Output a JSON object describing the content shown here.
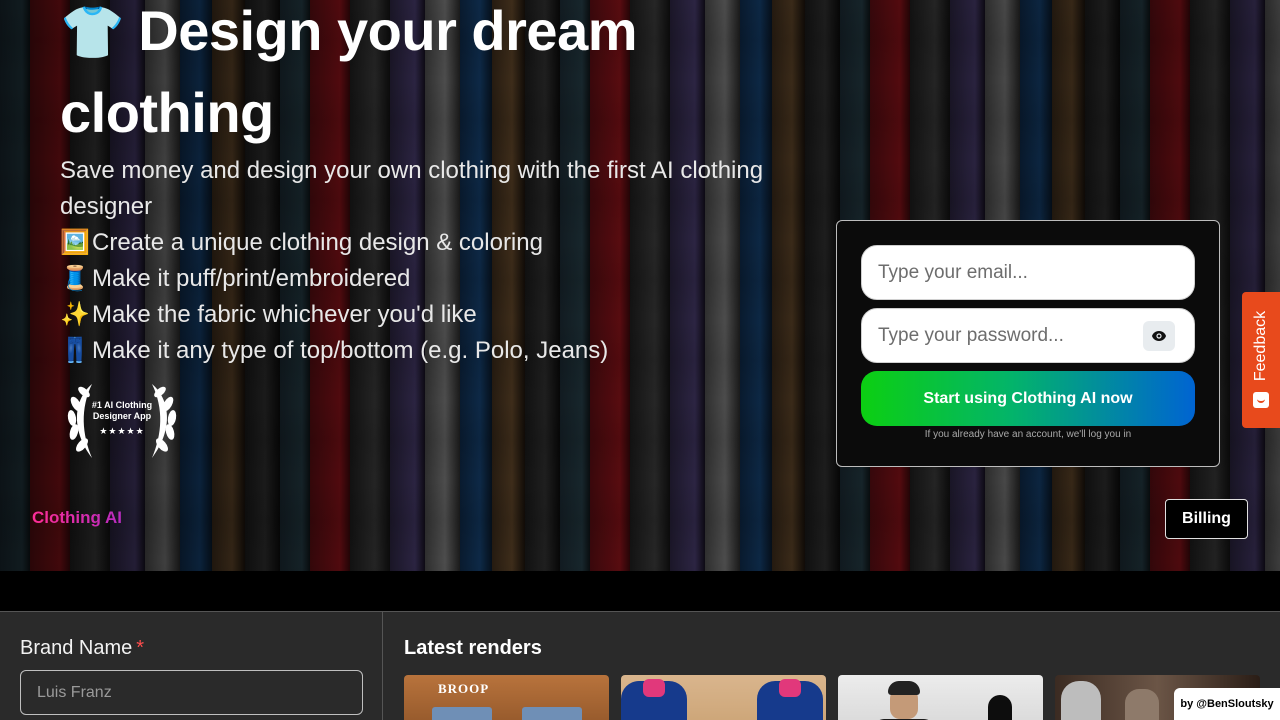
{
  "hero": {
    "title_emoji": "👕",
    "title": "Design your dream clothing",
    "subtitle": "Save money and design your own clothing with the first AI clothing designer",
    "features": [
      {
        "icon": "🖼️",
        "text": "Create a unique clothing design & coloring"
      },
      {
        "icon": "🧵",
        "text": "Make it puff/print/embroidered"
      },
      {
        "icon": "✨",
        "text": "Make the fabric whichever you'd like"
      },
      {
        "icon": "👖",
        "text": "Make it any type of top/bottom (e.g. Polo, Jeans)"
      }
    ],
    "award": {
      "line1": "#1 AI Clothing",
      "line2": "Designer App",
      "stars": "★★★★★"
    }
  },
  "signup": {
    "email_placeholder": "Type your email...",
    "password_placeholder": "Type your password...",
    "cta_label": "Start using Clothing AI now",
    "note": "If you already have an account, we'll log you in",
    "cta_gradient": [
      "#0ccf12",
      "#0064d2"
    ]
  },
  "nav": {
    "brand": "Clothing AI",
    "brand_mark": "™",
    "brand_color": "#ff2d95",
    "billing_label": "Billing"
  },
  "feedback": {
    "label": "Feedback",
    "color": "#e84a1c"
  },
  "form": {
    "brand_name_label": "Brand Name",
    "required_mark": "*",
    "brand_name_placeholder": "Luis Franz"
  },
  "renders": {
    "title": "Latest renders",
    "thumb1_label": "BROOP"
  },
  "credit": "by @BenSloutsky"
}
